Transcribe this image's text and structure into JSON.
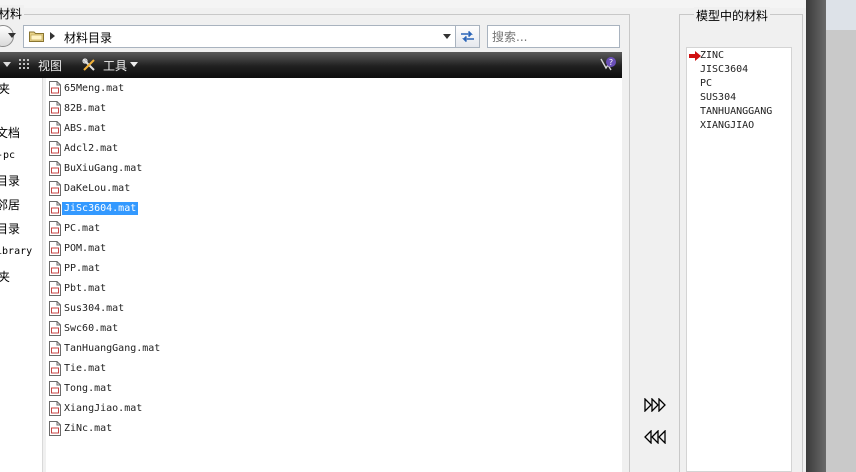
{
  "dialog": {
    "title_fragment": "材料"
  },
  "address_bar": {
    "path": "材料目录"
  },
  "search": {
    "placeholder": "搜索..."
  },
  "toolbar": {
    "view_label": "视图",
    "tools_label": "工具"
  },
  "nav_pane": {
    "items": [
      {
        "label": "夹"
      },
      {
        "label": "文档"
      },
      {
        "label": "-pc"
      },
      {
        "label": "目录"
      },
      {
        "label": "邻居"
      },
      {
        "label": "目录"
      },
      {
        "label": "Library"
      },
      {
        "label": "夹"
      }
    ]
  },
  "files": [
    {
      "name": "65Meng.mat"
    },
    {
      "name": "82B.mat"
    },
    {
      "name": "ABS.mat"
    },
    {
      "name": "Adcl2.mat"
    },
    {
      "name": "BuXiuGang.mat"
    },
    {
      "name": "DaKeLou.mat"
    },
    {
      "name": "JiSc3604.mat",
      "selected": true
    },
    {
      "name": "PC.mat"
    },
    {
      "name": "POM.mat"
    },
    {
      "name": "PP.mat"
    },
    {
      "name": "Pbt.mat"
    },
    {
      "name": "Sus304.mat"
    },
    {
      "name": "Swc60.mat"
    },
    {
      "name": "TanHuangGang.mat"
    },
    {
      "name": "Tie.mat"
    },
    {
      "name": "Tong.mat"
    },
    {
      "name": "XiangJiao.mat"
    },
    {
      "name": "ZiNc.mat"
    }
  ],
  "model_materials": {
    "title": "模型中的材料",
    "items": [
      "ZINC",
      "JISC3604",
      "PC",
      "SUS304",
      "TANHUANGGANG",
      "XIANGJIAO"
    ]
  },
  "icons": {
    "file": "mat-file-icon",
    "current_marker": "red-arrow-icon",
    "add": "triple-right-arrow-icon",
    "remove": "triple-left-arrow-icon"
  },
  "colors": {
    "selection": "#3399ff",
    "toolbar_dark": "#1a1a1a",
    "marker_red": "#d01010"
  }
}
